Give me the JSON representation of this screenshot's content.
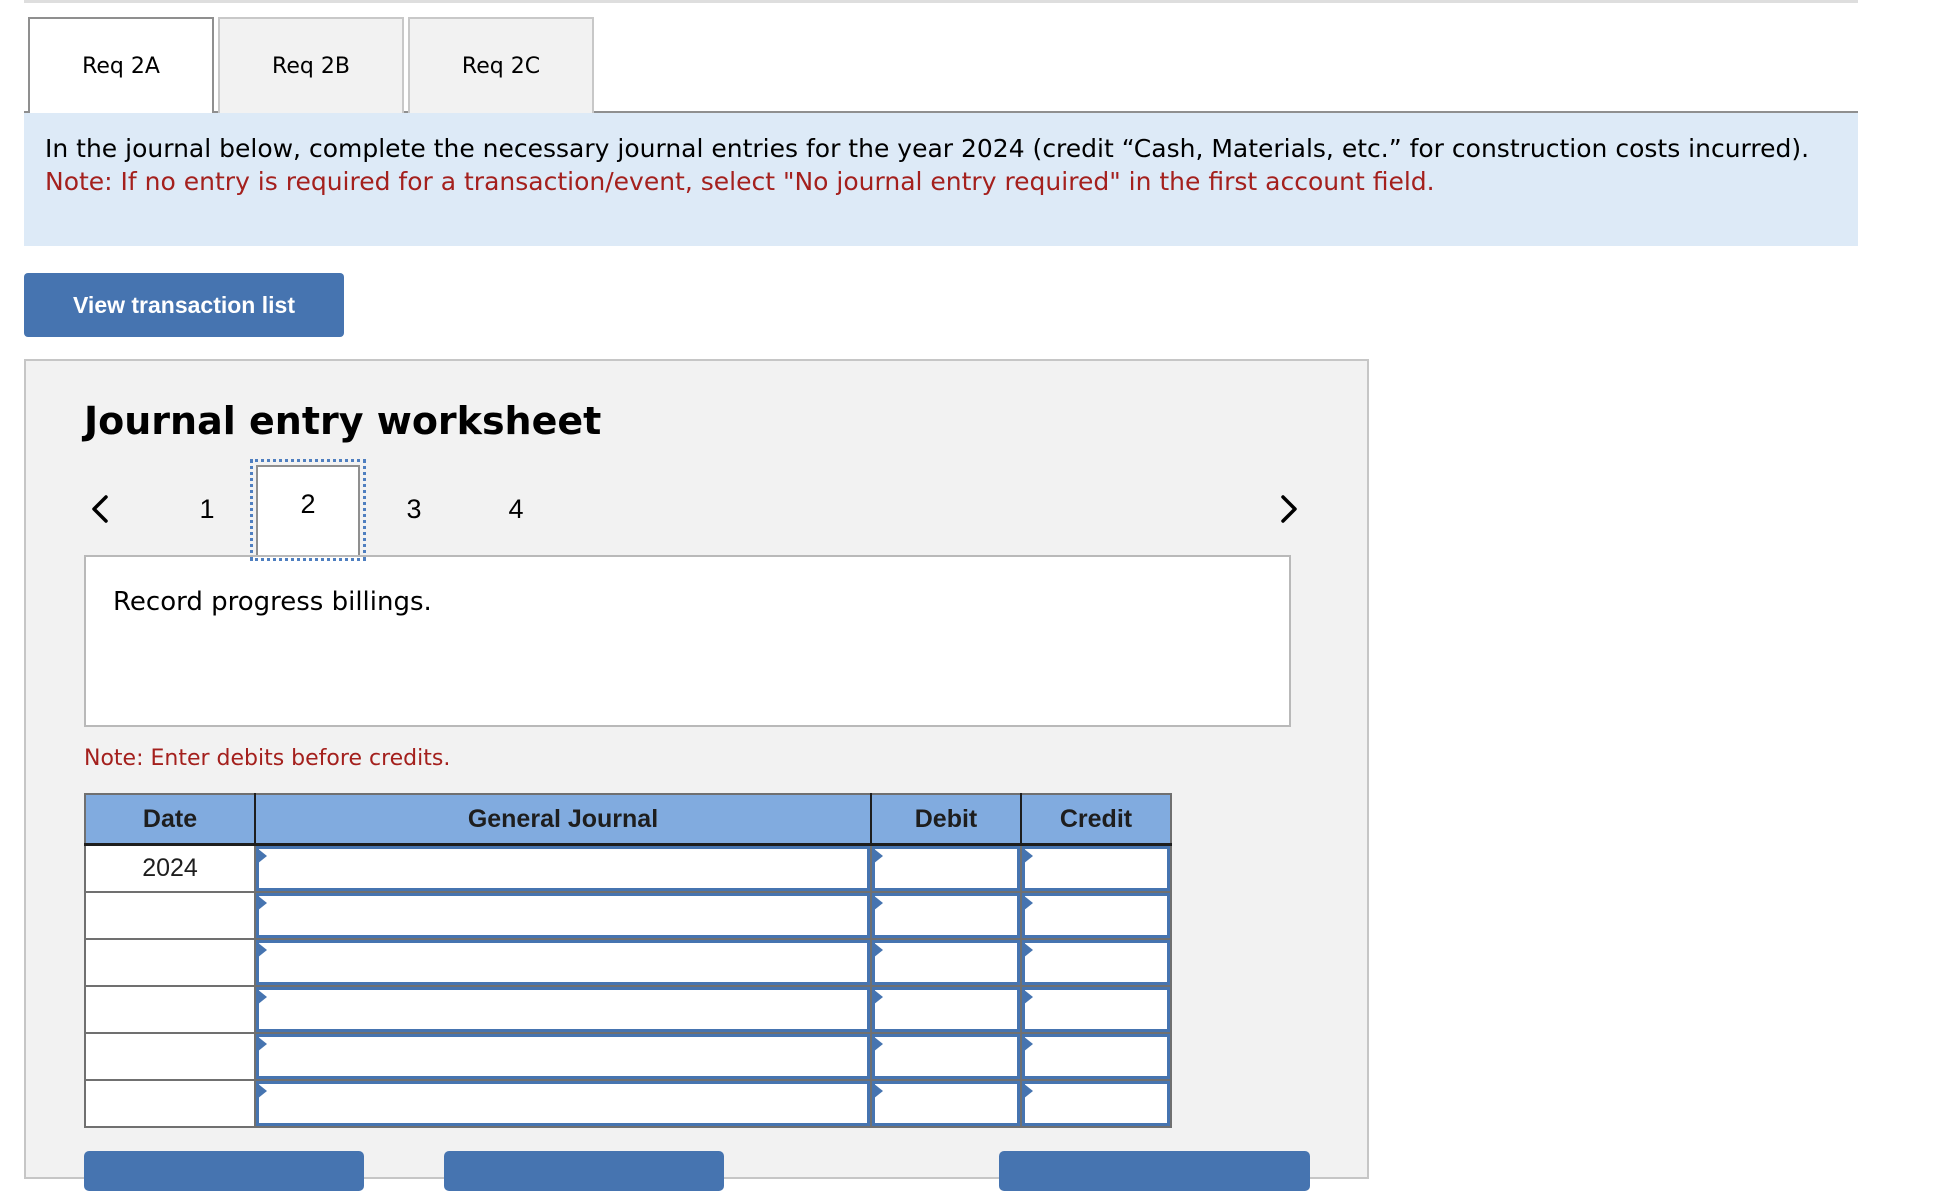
{
  "tabs": [
    {
      "label": "Req 2A",
      "active": true
    },
    {
      "label": "Req 2B",
      "active": false
    },
    {
      "label": "Req 2C",
      "active": false
    }
  ],
  "instructions": {
    "main": "In the journal below, complete the necessary journal entries for the year 2024 (credit “Cash, Materials, etc.” for construction costs incurred).",
    "note": "Note: If no entry is required for a transaction/event, select \"No journal entry required\" in the first account field."
  },
  "view_transaction_button": "View transaction list",
  "worksheet": {
    "title": "Journal entry worksheet",
    "nav": {
      "prev_icon": "chevron-left-icon",
      "next_icon": "chevron-right-icon",
      "pages": [
        "1",
        "2",
        "3",
        "4"
      ],
      "current_page": "2"
    },
    "description": "Record progress billings.",
    "debit_note": "Note: Enter debits before credits.",
    "table": {
      "headers": [
        "Date",
        "General Journal",
        "Debit",
        "Credit"
      ],
      "rows": [
        {
          "date": "2024",
          "account": "",
          "debit": "",
          "credit": ""
        },
        {
          "date": "",
          "account": "",
          "debit": "",
          "credit": ""
        },
        {
          "date": "",
          "account": "",
          "debit": "",
          "credit": ""
        },
        {
          "date": "",
          "account": "",
          "debit": "",
          "credit": ""
        },
        {
          "date": "",
          "account": "",
          "debit": "",
          "credit": ""
        },
        {
          "date": "",
          "account": "",
          "debit": "",
          "credit": ""
        }
      ]
    }
  },
  "colors": {
    "accent_blue": "#4674b0",
    "header_blue": "#81abdf",
    "instruction_bg": "#ddeaf7",
    "note_red": "#a4201d"
  }
}
